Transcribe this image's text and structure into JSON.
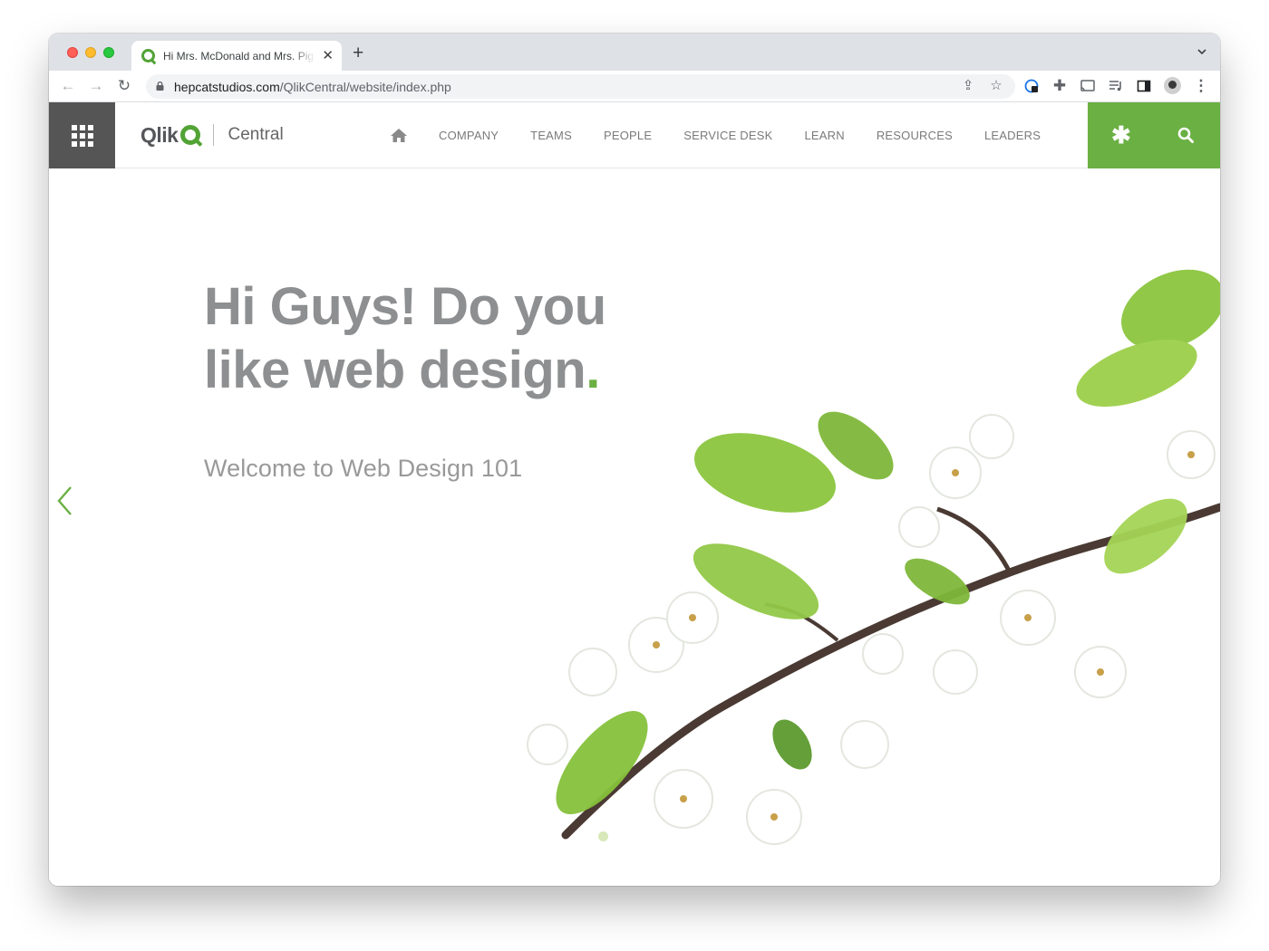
{
  "browser": {
    "tab_title": "Hi Mrs. McDonald and Mrs. Pig",
    "url_host": "hepcatstudios.com",
    "url_path": "/QlikCentral/website/index.php",
    "icons": [
      "back-arrow-icon",
      "forward-arrow-icon",
      "reload-icon",
      "lock-icon",
      "share-icon",
      "star-icon",
      "extension-icon",
      "puzzle-icon",
      "cast-icon",
      "media-icon",
      "sidepanel-icon",
      "profile-avatar",
      "kebab-menu-icon"
    ]
  },
  "site": {
    "logo_word": "Qlik",
    "logo_suffix": "Central",
    "nav": [
      "COMPANY",
      "TEAMS",
      "PEOPLE",
      "SERVICE DESK",
      "LEARN",
      "RESOURCES",
      "LEADERS"
    ],
    "colors": {
      "accent": "#6ab043",
      "grid_button": "#555555",
      "nav_text": "#7a7a7a"
    }
  },
  "hero": {
    "title": "Hi Guys! Do you like web design",
    "title_dot": ".",
    "subtitle": "Welcome to Web Design 101"
  }
}
